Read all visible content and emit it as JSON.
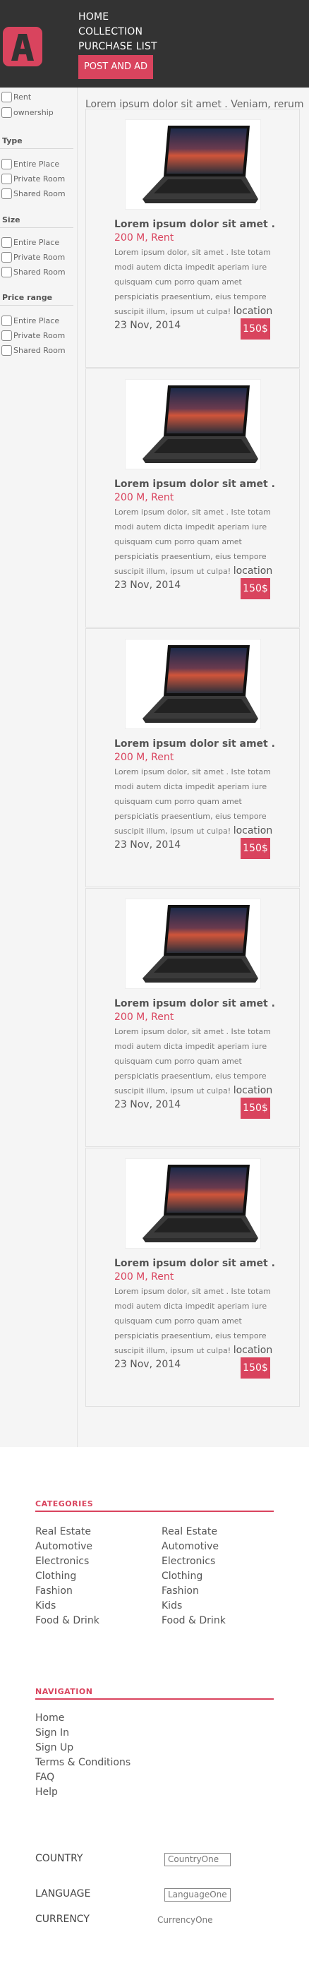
{
  "header": {
    "nav": [
      "HOME",
      "COLLECTION",
      "PURCHASE LIST"
    ],
    "post_button": "POST AND AD",
    "brand_color": "#d9445e",
    "logo_icon": "letter-a-logo"
  },
  "sidebar": {
    "top_options": [
      "Rent",
      "ownership"
    ],
    "type": {
      "heading": "Type",
      "options": [
        "Entire Place",
        "Private Room",
        "Shared Room"
      ]
    },
    "size": {
      "heading": "Size",
      "options": [
        "Entire Place",
        "Private Room",
        "Shared Room"
      ]
    },
    "price_range": {
      "heading": "Price range",
      "options": [
        "Entire Place",
        "Private Room",
        "Shared Room"
      ]
    }
  },
  "intro": "Lorem ipsum dolor sit amet . Veniam, rerum atque porro officiis vitae consequuntur esse. Eaque.",
  "cards": [
    {
      "title": "Lorem ipsum dolor sit amet .",
      "price": "200 M, Rent",
      "description": "Lorem ipsum dolor, sit amet . Iste totam modi autem dicta impedit aperiam iure quisquam cum porro quam amet perspiciatis praesentium, eius tempore suscipit illum, ipsum ut culpa!",
      "location": "location",
      "date": "23 Nov, 2014",
      "badge": "150$"
    },
    {
      "title": "Lorem ipsum dolor sit amet .",
      "price": "200 M, Rent",
      "description": "Lorem ipsum dolor, sit amet . Iste totam modi autem dicta impedit aperiam iure quisquam cum porro quam amet perspiciatis praesentium, eius tempore suscipit illum, ipsum ut culpa!",
      "location": "location",
      "date": "23 Nov, 2014",
      "badge": "150$"
    },
    {
      "title": "Lorem ipsum dolor sit amet .",
      "price": "200 M, Rent",
      "description": "Lorem ipsum dolor, sit amet . Iste totam modi autem dicta impedit aperiam iure quisquam cum porro quam amet perspiciatis praesentium, eius tempore suscipit illum, ipsum ut culpa!",
      "location": "location",
      "date": "23 Nov, 2014",
      "badge": "150$"
    },
    {
      "title": "Lorem ipsum dolor sit amet .",
      "price": "200 M, Rent",
      "description": "Lorem ipsum dolor, sit amet . Iste totam modi autem dicta impedit aperiam iure quisquam cum porro quam amet perspiciatis praesentium, eius tempore suscipit illum, ipsum ut culpa!",
      "location": "location",
      "date": "23 Nov, 2014",
      "badge": "150$"
    },
    {
      "title": "Lorem ipsum dolor sit amet .",
      "price": "200 M, Rent",
      "description": "Lorem ipsum dolor, sit amet . Iste totam modi autem dicta impedit aperiam iure quisquam cum porro quam amet perspiciatis praesentium, eius tempore suscipit illum, ipsum ut culpa!",
      "location": "location",
      "date": "23 Nov, 2014",
      "badge": "150$"
    }
  ],
  "footer": {
    "categories_heading": "CATEGORIES",
    "categories_col1": [
      "Real Estate",
      "Automotive",
      "Electronics",
      "Clothing",
      "Fashion",
      "Kids",
      "Food & Drink"
    ],
    "categories_col2": [
      "Real Estate",
      "Automotive",
      "Electronics",
      "Clothing",
      "Fashion",
      "Kids",
      "Food & Drink"
    ],
    "navigation_heading": "NAVIGATION",
    "navigation_links": [
      "Home",
      "Sign In",
      "Sign Up",
      "Terms & Conditions",
      "FAQ",
      "Help"
    ],
    "country_label": "COUNTRY",
    "country_value": "CountryOne",
    "language_label": "LANGUAGE",
    "language_value": "LanguageOne",
    "currency_label": "CURRENCY",
    "currency_value": "CurrencyOne"
  }
}
